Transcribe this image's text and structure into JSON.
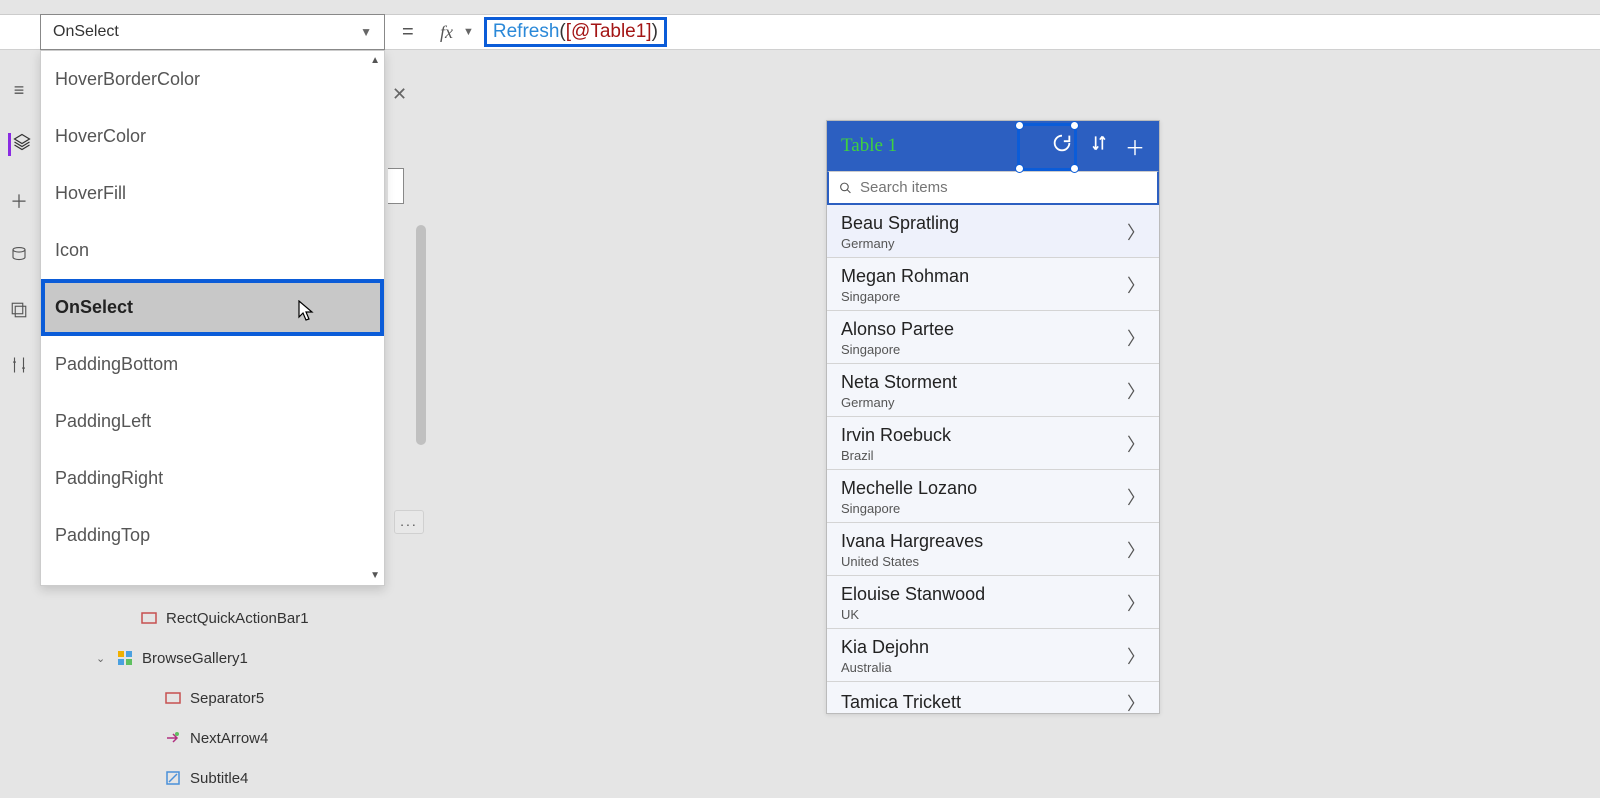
{
  "formula_bar": {
    "selected_property": "OnSelect",
    "fx_label": "fx",
    "equals": "=",
    "formula_call": "Refresh",
    "formula_open": "(",
    "formula_param": "[@Table1]",
    "formula_close": ")"
  },
  "property_dropdown": {
    "items": [
      {
        "label": "HoverBorderColor",
        "selected": false
      },
      {
        "label": "HoverColor",
        "selected": false
      },
      {
        "label": "HoverFill",
        "selected": false
      },
      {
        "label": "Icon",
        "selected": false
      },
      {
        "label": "OnSelect",
        "selected": true
      },
      {
        "label": "PaddingBottom",
        "selected": false
      },
      {
        "label": "PaddingLeft",
        "selected": false
      },
      {
        "label": "PaddingRight",
        "selected": false
      },
      {
        "label": "PaddingTop",
        "selected": false
      }
    ]
  },
  "tree": {
    "items": [
      {
        "label": "RectQuickActionBar1",
        "icon": "rect",
        "indent": 1
      },
      {
        "label": "BrowseGallery1",
        "icon": "gallery",
        "indent": 0,
        "expanded": true
      },
      {
        "label": "Separator5",
        "icon": "rect",
        "indent": 2
      },
      {
        "label": "NextArrow4",
        "icon": "arrow",
        "indent": 2
      },
      {
        "label": "Subtitle4",
        "icon": "text",
        "indent": 2
      }
    ]
  },
  "phone": {
    "title": "Table 1",
    "search_placeholder": "Search items",
    "rows": [
      {
        "name": "Beau Spratling",
        "sub": "Germany"
      },
      {
        "name": "Megan Rohman",
        "sub": "Singapore"
      },
      {
        "name": "Alonso Partee",
        "sub": "Singapore"
      },
      {
        "name": "Neta Storment",
        "sub": "Germany"
      },
      {
        "name": "Irvin Roebuck",
        "sub": "Brazil"
      },
      {
        "name": "Mechelle Lozano",
        "sub": "Singapore"
      },
      {
        "name": "Ivana Hargreaves",
        "sub": "United States"
      },
      {
        "name": "Elouise Stanwood",
        "sub": "UK"
      },
      {
        "name": "Kia Dejohn",
        "sub": "Australia"
      },
      {
        "name": "Tamica Trickett",
        "sub": ""
      }
    ]
  },
  "ellipsis": "..."
}
